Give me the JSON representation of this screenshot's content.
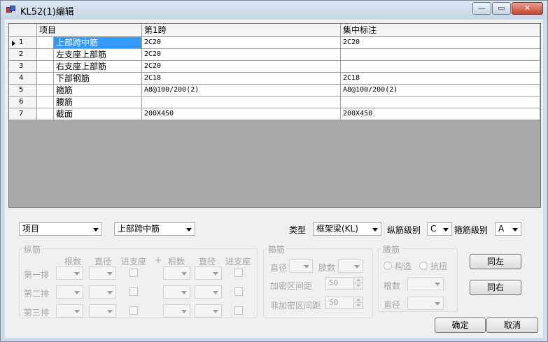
{
  "window": {
    "title": "KL52(1)编辑",
    "min": "—",
    "max": "▭",
    "close": "✕"
  },
  "grid": {
    "headers": [
      "项目",
      "第1跨",
      "集中标注"
    ],
    "rows": [
      {
        "num": "1",
        "item": "上部跨中筋",
        "span1": "2C20",
        "note": "2C20"
      },
      {
        "num": "2",
        "item": "左支座上部筋",
        "span1": "2C20",
        "note": ""
      },
      {
        "num": "3",
        "item": "右支座上部筋",
        "span1": "2C20",
        "note": ""
      },
      {
        "num": "4",
        "item": "下部钢筋",
        "span1": "2C18",
        "note": "2C18"
      },
      {
        "num": "5",
        "item": "箍筋",
        "span1": "A8@100/200(2)",
        "note": "A8@100/200(2)"
      },
      {
        "num": "6",
        "item": "腰筋",
        "span1": "",
        "note": ""
      },
      {
        "num": "7",
        "item": "截面",
        "span1": "200X450",
        "note": "200X450"
      }
    ]
  },
  "filters": {
    "field": "项目",
    "item": "上部跨中筋",
    "type_label": "类型",
    "type_value": "框架梁(KL)",
    "long_grade_label": "纵筋级别",
    "long_grade_value": "C",
    "stirrup_grade_label": "箍筋级别",
    "stirrup_grade_value": "A"
  },
  "longitudinal": {
    "title": "纵筋",
    "col_count": "根数",
    "col_diameter": "直径",
    "col_into_support": "进支座",
    "plus": "+",
    "rows": [
      "第一排",
      "第二排",
      "第三排"
    ]
  },
  "stirrup": {
    "title": "箍筋",
    "diameter": "直径",
    "legs": "肢数",
    "dense_spacing": "加密区间距",
    "dense_value": "50",
    "nondense_spacing": "非加密区间距",
    "nondense_value": "50"
  },
  "waist": {
    "title": "腰筋",
    "construct": "构造",
    "torsion": "抗扭",
    "count": "根数",
    "diameter": "直径"
  },
  "buttons": {
    "same_left": "同左",
    "same_right": "同右",
    "ok": "确定",
    "cancel": "取消"
  }
}
